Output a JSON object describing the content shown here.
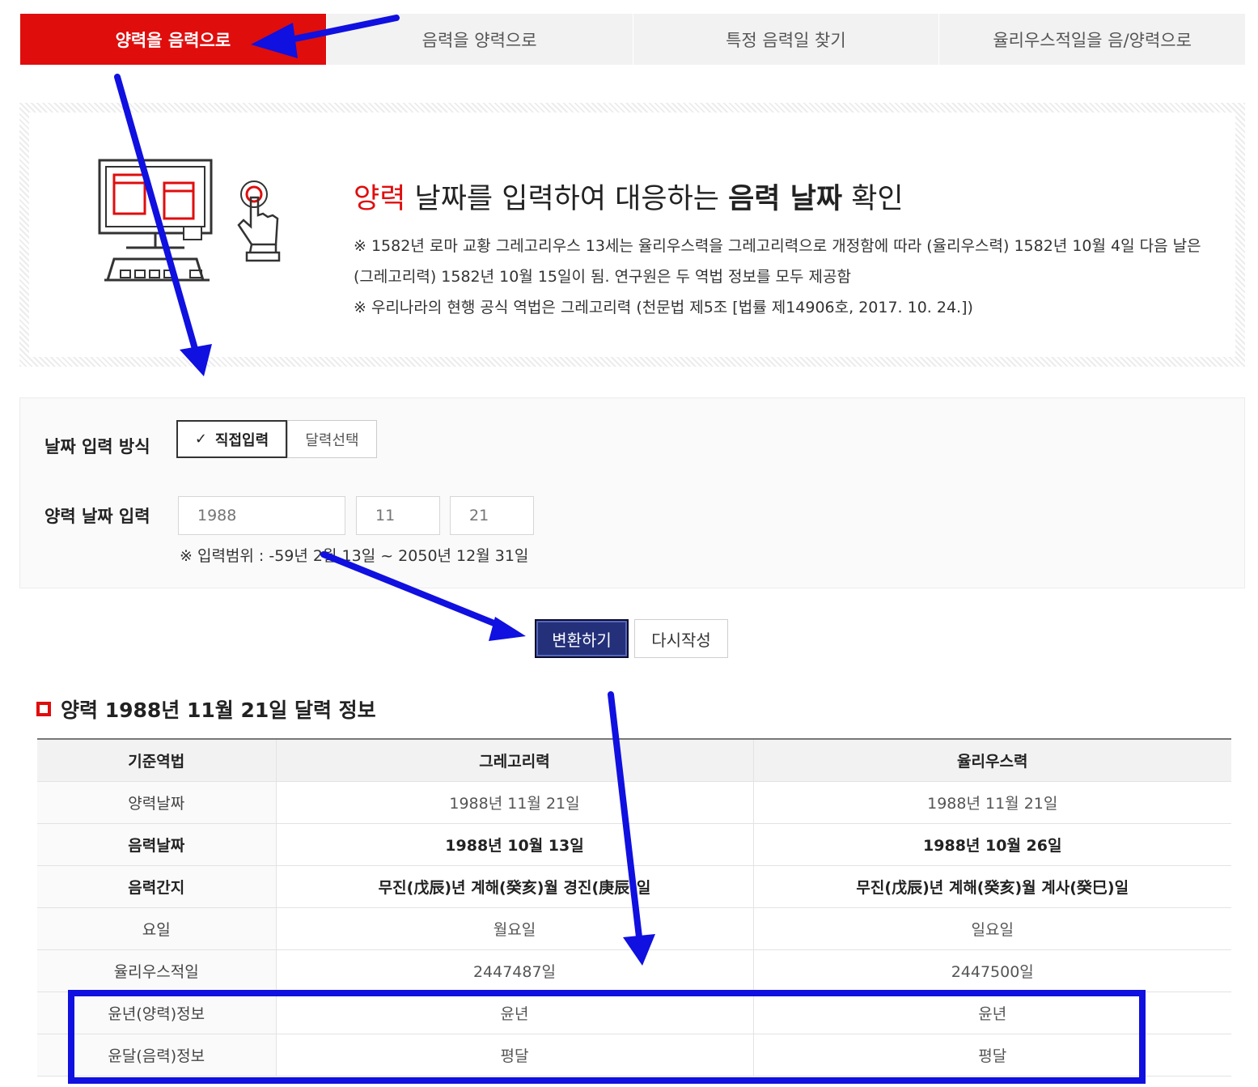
{
  "tabs": [
    {
      "label": "양력을 음력으로",
      "active": true
    },
    {
      "label": "음력을 양력으로",
      "active": false
    },
    {
      "label": "특정 음력일 찾기",
      "active": false
    },
    {
      "label": "율리우스적일을 음/양력으로",
      "active": false
    }
  ],
  "intro": {
    "headline_red": "양력",
    "headline_mid": " 날짜를 입력하여 대응하는 ",
    "headline_bold": "음력 날짜",
    "headline_end": " 확인",
    "note1": "※ 1582년 로마 교황 그레고리우스 13세는 율리우스력을 그레고리력으로 개정함에 따라 (율리우스력) 1582년 10월 4일 다음 날은 (그레고리력) 1582년 10월 15일이 됨. 연구원은 두 역법 정보를 모두 제공함",
    "note2": "※ 우리나라의 현행 공식 역법은 그레고리력 (천문법 제5조 [법률 제14906호, 2017. 10. 24.])"
  },
  "form": {
    "method_label": "날짜 입력 방식",
    "method_direct": "직접입력",
    "method_calendar": "달력선택",
    "date_label": "양력 날짜 입력",
    "year": "1988",
    "month": "11",
    "day": "21",
    "range_note": "※ 입력범위 : -59년 2월 13일 ~ 2050년 12월 31일"
  },
  "buttons": {
    "convert": "변환하기",
    "reset": "다시작성"
  },
  "result": {
    "title": "양력 1988년 11월 21일 달력 정보",
    "headers": [
      "기준역법",
      "그레고리력",
      "율리우스력"
    ],
    "rows": [
      {
        "label": "양력날짜",
        "gregorian": "1988년 11월 21일",
        "julian": "1988년 11월 21일"
      },
      {
        "label": "음력날짜",
        "gregorian": "1988년 10월 13일",
        "julian": "1988년 10월 26일"
      },
      {
        "label": "음력간지",
        "gregorian": "무진(戊辰)년 계해(癸亥)월 경진(庚辰)일",
        "julian": "무진(戊辰)년 계해(癸亥)월 계사(癸巳)일"
      },
      {
        "label": "요일",
        "gregorian": "월요일",
        "julian": "일요일"
      },
      {
        "label": "율리우스적일",
        "gregorian": "2447487일",
        "julian": "2447500일"
      },
      {
        "label": "윤년(양력)정보",
        "gregorian": "윤년",
        "julian": "윤년"
      },
      {
        "label": "윤달(음력)정보",
        "gregorian": "평달",
        "julian": "평달"
      }
    ]
  },
  "colors": {
    "brand_red": "#e00d0d",
    "primary_button": "#24307a",
    "annotation_blue": "#1010e0"
  }
}
